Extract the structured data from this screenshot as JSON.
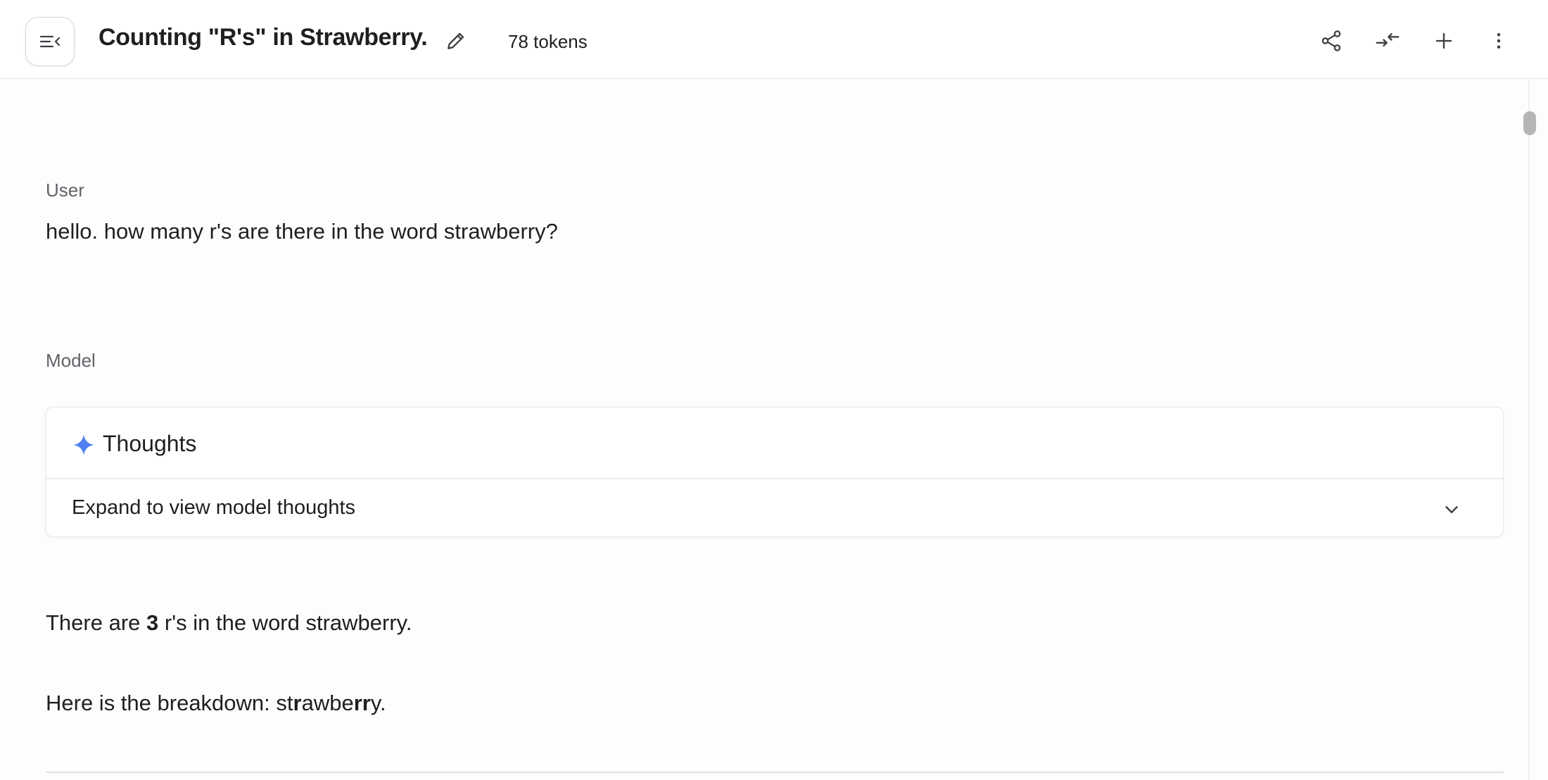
{
  "header": {
    "title": "Counting \"R's\" in Strawberry.",
    "tokens": "78 tokens",
    "icons": [
      "menu-collapse-icon",
      "pencil-icon",
      "share-icon",
      "compare-icon",
      "plus-icon",
      "more-vert-icon"
    ]
  },
  "conversation": {
    "user_label": "User",
    "user_message": "hello. how many r's are there in the word strawberry?",
    "model_label": "Model",
    "thoughts": {
      "title": "Thoughts",
      "expand_text": "Expand to view model thoughts"
    },
    "answer_line1": {
      "before": "There are ",
      "bold": "3",
      "after": " r's in the word strawberry."
    },
    "answer_line2": {
      "prefix": "Here is the breakdown: ",
      "parts": [
        "st",
        "r",
        "awbe",
        "rr",
        "y."
      ]
    }
  },
  "colors": {
    "accent_spark": "#4f7ef0",
    "text": "#1f1f1f",
    "muted": "#5f6368"
  }
}
